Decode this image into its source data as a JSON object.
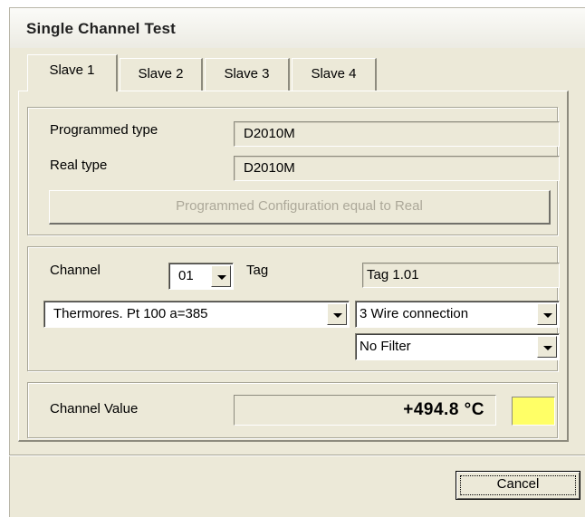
{
  "window": {
    "title": "Single Channel Test"
  },
  "tabs": [
    {
      "label": "Slave 1",
      "active": true
    },
    {
      "label": "Slave 2",
      "active": false
    },
    {
      "label": "Slave 3",
      "active": false
    },
    {
      "label": "Slave 4",
      "active": false
    }
  ],
  "type_group": {
    "programmed_type_label": "Programmed type",
    "programmed_type_value": "D2010M",
    "real_type_label": "Real type",
    "real_type_value": "D2010M",
    "config_button_label": "Programmed Configuration equal to Real"
  },
  "channel_group": {
    "channel_label": "Channel",
    "channel_value": "01",
    "tag_label": "Tag",
    "tag_value": "Tag 1.01",
    "sensor_type_value": "Thermores. Pt 100 a=385",
    "connection_value": "3 Wire connection",
    "filter_value": "No Filter"
  },
  "value_group": {
    "channel_value_label": "Channel Value",
    "channel_value_reading": "+494.8 °C",
    "indicator_color": "#ffff66"
  },
  "footer": {
    "cancel_label": "Cancel"
  }
}
